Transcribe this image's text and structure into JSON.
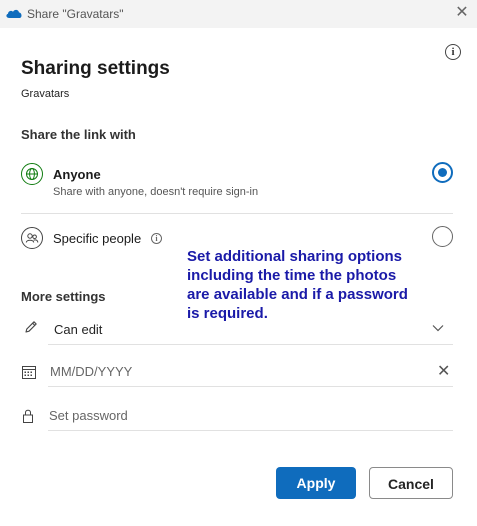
{
  "window": {
    "title": "Share \"Gravatars\""
  },
  "header": {
    "title": "Sharing settings",
    "item_name": "Gravatars"
  },
  "share_link": {
    "label": "Share the link with",
    "options": [
      {
        "title": "Anyone",
        "description": "Share with anyone, doesn't require sign-in",
        "icon": "globe-icon",
        "selected": true
      },
      {
        "title": "Specific people",
        "description": "",
        "icon": "people-icon",
        "selected": false
      }
    ]
  },
  "annotation": {
    "text": "Set additional sharing options\nincluding the time the photos\nare available and if a password\nis required."
  },
  "more_settings": {
    "label": "More settings",
    "permission": {
      "value": "Can edit"
    },
    "expiry": {
      "placeholder": "MM/DD/YYYY"
    },
    "password": {
      "placeholder": "Set password"
    }
  },
  "buttons": {
    "apply": "Apply",
    "cancel": "Cancel"
  },
  "colors": {
    "accent": "#0f6cbd",
    "annotation": "#1a1aa8",
    "globe": "#107c10"
  }
}
